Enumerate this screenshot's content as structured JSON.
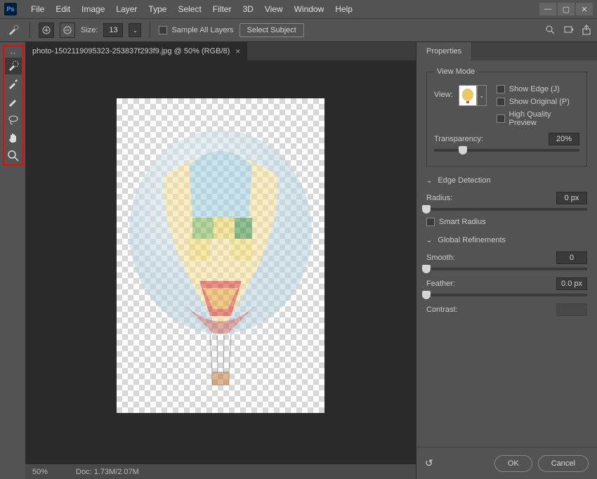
{
  "menu": [
    "File",
    "Edit",
    "Image",
    "Layer",
    "Type",
    "Select",
    "Filter",
    "3D",
    "View",
    "Window",
    "Help"
  ],
  "optbar": {
    "size_label": "Size:",
    "size_value": "13",
    "sample_all": "Sample All Layers",
    "select_subject": "Select Subject"
  },
  "doc": {
    "tab": "photo-1502119095323-253837f293f9.jpg @ 50% (RGB/8)",
    "zoom": "50%",
    "docsize": "Doc: 1.73M/2.07M"
  },
  "panel": {
    "tab": "Properties",
    "viewmode_legend": "View Mode",
    "view_label": "View:",
    "show_edge": "Show Edge (J)",
    "show_original": "Show Original (P)",
    "high_quality": "High Quality Preview",
    "transparency_label": "Transparency:",
    "transparency_value": "20%",
    "edge_detection": "Edge Detection",
    "radius_label": "Radius:",
    "radius_value": "0 px",
    "smart_radius": "Smart Radius",
    "global_refinements": "Global Refinements",
    "smooth_label": "Smooth:",
    "smooth_value": "0",
    "feather_label": "Feather:",
    "feather_value": "0.0 px",
    "contrast_label": "Contrast:",
    "ok": "OK",
    "cancel": "Cancel"
  }
}
